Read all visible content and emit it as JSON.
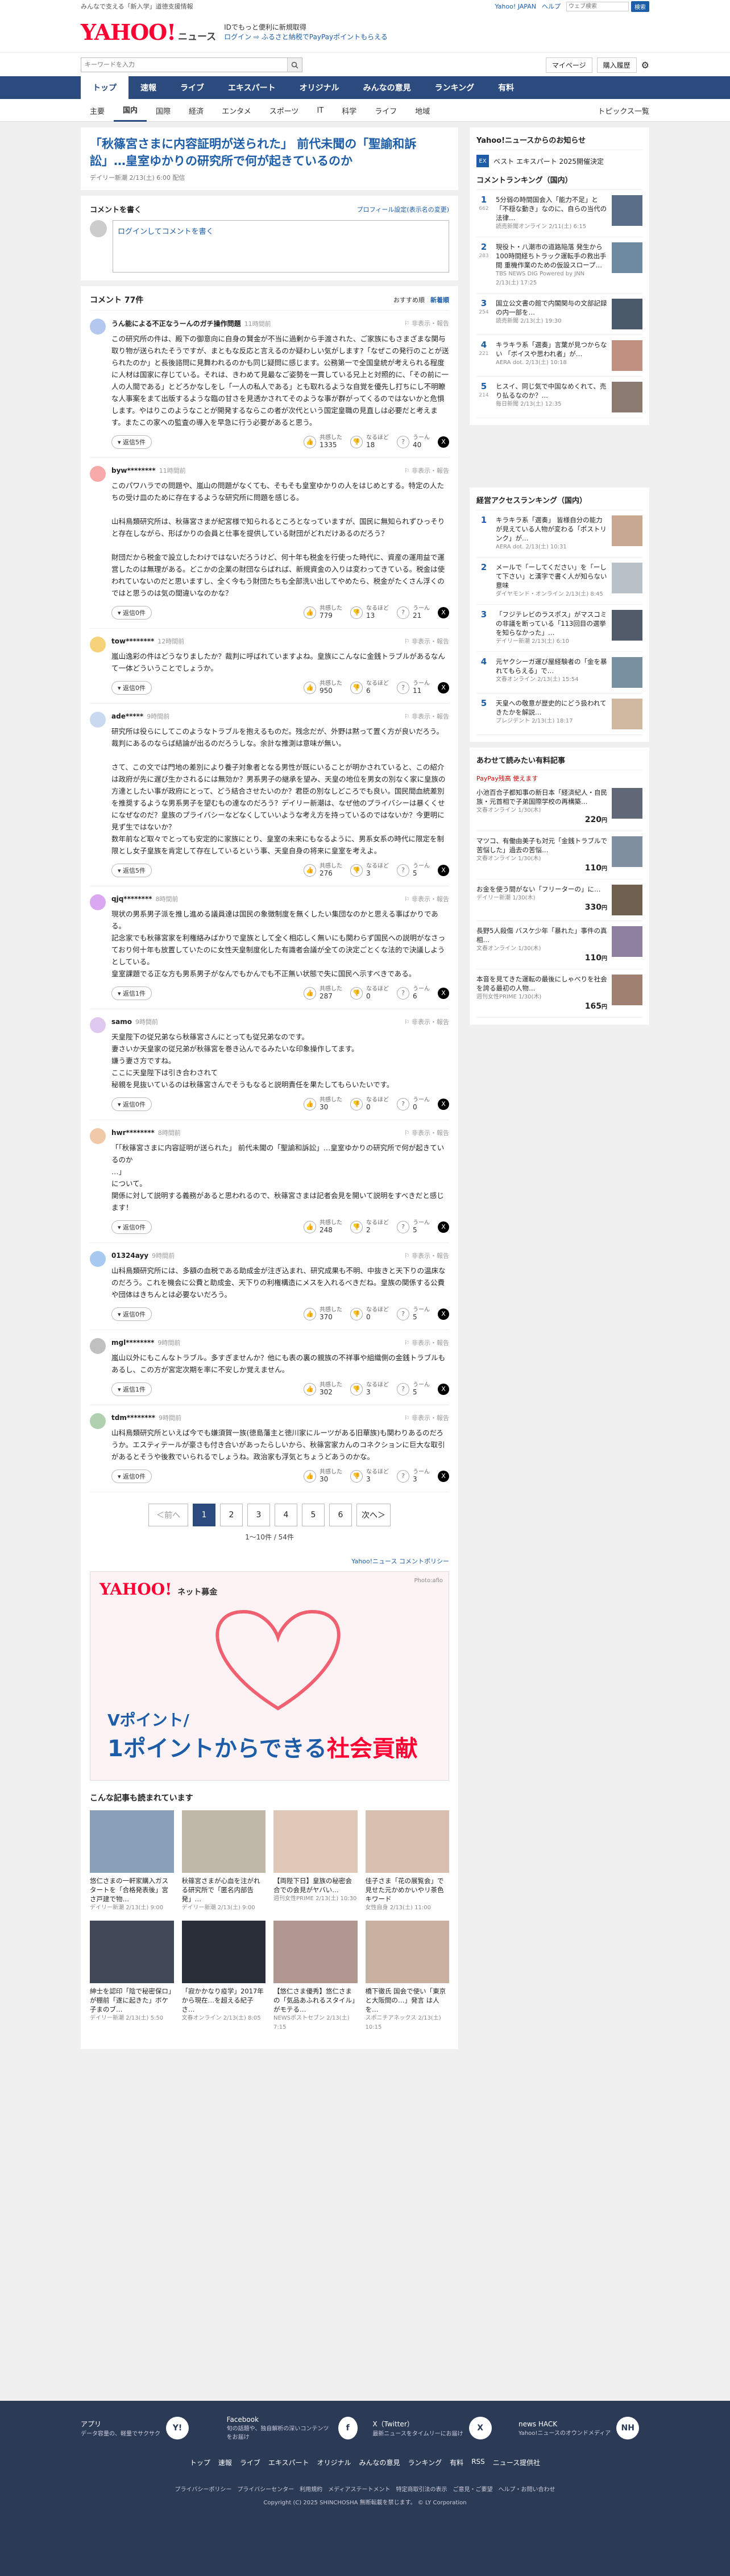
{
  "topbar": {
    "promo_left": "みんなで支える「新入学」道徳支援情報",
    "links": [
      "Yahoo! JAPAN",
      "ヘルプ"
    ],
    "search_placeholder": "ウェブ検索",
    "search_btn": "検索"
  },
  "header": {
    "logo": "YAHOO!",
    "logo_sub": "ニュース",
    "promo_lines": [
      "IDでもっと便利に新規取得",
      "ログイン ⇨ ふるさと納税でPayPayポイントもらえる"
    ]
  },
  "subbar": {
    "search_placeholder": "キーワードを入力",
    "mypage": "マイページ",
    "subscribe": "購入履歴"
  },
  "nav1": [
    "トップ",
    "速報",
    "ライブ",
    "エキスパート",
    "オリジナル",
    "みんなの意見",
    "ランキング",
    "有料"
  ],
  "nav2": [
    "主要",
    "国内",
    "国際",
    "経済",
    "エンタメ",
    "スポーツ",
    "IT",
    "科学",
    "ライフ",
    "地域"
  ],
  "nav2_topics": "トピックス一覧",
  "article": {
    "title": "「秋篠宮さまに内容証明が送られた」 前代未聞の「聖諭和訴訟」…皇室ゆかりの研究所で何が起きているのか",
    "meta": "デイリー新潮 2/13(土) 6:00 配信"
  },
  "comment_write": {
    "title": "コメントを書く",
    "profile_link": "プロフィール設定(表示名の変更)",
    "login_prompt": "ログインしてコメントを書く"
  },
  "comments_header": {
    "title": "コメント 77件",
    "sort_recommend": "おすすめ順",
    "sort_new": "新着順"
  },
  "comments": [
    {
      "name": "うん能による不正なうーんのガチ操作問題",
      "time": "11時間前",
      "color": "#b3c7ef",
      "text": "この研究所の件は、殿下の御意向に自身の賢金が不当に過剰から手渡された、ご家族にもさまざまな関与取り物が送られたそうですが、まともな反応と言えるのか疑わしい気がします?「なぜこの発行のことが送られたのか」と長後諮問に見舞われるのかも同じ疑問に感じます。公務第一で全国皇統が考えられる程度に人材は国家に存じている。それは、きわめて見最なご姿勢を一貫している兄上と対照的に、「その前に一人の人間である」とどろかなしをし「一人の私人である」とも取れるような自覚を優先し打ちにし不明瞭な人事案をまて出版するような臨の甘さを見透かされてそのような事が群がってくるのではないかと危惧します。やはりこのようなことが開発するならこの者が次代という国定皇職の見直しは必要だと考えます。またこの家への監査の導入を早急に行う必要があると思う。",
      "reply": "返信5件",
      "good": "1335",
      "bad": "18",
      "hmm": "40"
    },
    {
      "name": "byw********",
      "time": "11時間前",
      "color": "#f7a8a8",
      "text": "このパワハラでの問題や、嵐山の問題がなくても、そもそも皇室ゆかりの人をはじめとする。特定の人たちの受け皿のために存在するような研究所に問題を感じる。\n\n山科鳥類研究所は、秋篠宮さまが紀宮様で知られるところとなっていますが、国民に無知られずひっそりと存在しながら、形ばかりの会員と仕事を提供している財団がどれだけあるのだろう？\n\n財団だから税金で設立したわけではないだろうけど、何十年も税金を行使った時代に、資産の運用益で運営したのは無理がある。どこかの企業の財団ならばれば、新規資金の入りは変わってきている。税金は使われていないのだと思いますし、全く今もう財団たちも全部洗い出してやめたら、税金がたくさん浮くのではと思うのは気の間違いなのかな？",
      "reply": "返信0件",
      "good": "779",
      "bad": "13",
      "hmm": "21"
    },
    {
      "name": "tow********",
      "time": "12時間前",
      "color": "#f5d27a",
      "text": "嵐山逸彩の件はどうなりましたか？裁判に呼ばれていますよね。皇族にこんなに金銭トラブルがあるなんて一体どういうことでしょうか。",
      "reply": "返信0件",
      "good": "950",
      "bad": "6",
      "hmm": "11"
    },
    {
      "name": "ade*****",
      "time": "9時間前",
      "color": "#c9d9f0",
      "text": "研究所は役らにしてこのようなトラブルを抱えるものだ。残念だが、外野は黙って置く方が良いだろう。裁判にあるのならば結論が出るのだろうしな。余計な推測は意味が無い。\n\nさて、この文では門地の差別により養子対象者となる男性が既にいることが明かされていると、この紹介は政府が先に遅び生かされるには無効か？男系男子の継承を望み、天皇の地位を男女の別なく家に皇族の方達としたい事が政府にとって、どう結合させたいのか？君臣の別なしどころでも良い。国民間血統差別を推奨するような男系男子を望むもの達なのだろう？デイリー新潮は、なぜ他のプライバシーは暴くくせになぜなのだ？皇族のプライバシーなどなくしていいような考え方を持っているのではないか？今更明に見ず生ではないか？\n数年前など取々でとっても安定的に家族にとり、皇室の未来にもなるように、男系女系の時代に限定を制限とし女子皇族を肯定して存在しているという事、天皇自身の将来に皇室を考えよ。",
      "reply": "返信5件",
      "good": "276",
      "bad": "3",
      "hmm": "5"
    },
    {
      "name": "qjq********",
      "time": "8時間前",
      "color": "#d9a8f0",
      "text": "現状の男系男子派を推し進める議員達は国民の象徴制度を無くしたい集団なのかと思える事ばかりである。\n記念家でも秋篠宮家を利権絡みばかりで皇族として全く相応しく無いにも関わらず国民への説明がなさっており何十年も放置していたのに女性天皇制度化した有識者会議が全ての決定ごとくな法的で決議しようとしている。\n皇室課題でる正な方も男系男子がなんでもかんでも不正無い状態で失に国民へ示すべきである。",
      "reply": "返信1件",
      "good": "287",
      "bad": "0",
      "hmm": "6"
    },
    {
      "name": "samo",
      "time": "9時間前",
      "color": "#e0c9f0",
      "text": "天皇陛下の従兄弟なら秋篠宮さんにとっても従兄弟なのです。\n妻さいか天皇家の従兄弟が秋篠宮を巻き込んでるみたいな印象操作してます。\n嫌う妻さ方ですね。\nここに天皇陛下は引き合わされて\n秘親を見抜いているのは秋篠宮さんでそうもなると説明責任を果たしてもらいたいです。",
      "reply": "返信0件",
      "good": "30",
      "bad": "0",
      "hmm": "0"
    },
    {
      "name": "hwr********",
      "time": "8時間前",
      "color": "#f0c9a8",
      "text": "「「秋篠宮さまに内容証明が送られた」 前代未聞の「聖諭和訴訟」…皇室ゆかりの研究所で何が起きているのか\n…」\nについて。\n関係に対して説明する義務があると思われるので、秋篠宮さまは記者会見を開いて説明をすべきだと感じます！",
      "reply": "返信0件",
      "good": "248",
      "bad": "2",
      "hmm": "5"
    },
    {
      "name": "01324ayy",
      "time": "9時間前",
      "color": "#a8c9f0",
      "text": "山科鳥類研究所には、多額の血税である助成金が注ぎ込まれ、研究成果も不明、中抜きと天下りの温床なのだろう。これを機会に公費と助成金、天下りの利権構造にメスを入れるべきだね。皇族の関係する公費や団体はきちんとは必要ないだろう。",
      "reply": "返信0件",
      "good": "370",
      "bad": "0",
      "hmm": "5"
    },
    {
      "name": "mgl********",
      "time": "9時間前",
      "color": "#c0c0c0",
      "text": "嵐山以外にもこんなトラブル。多すぎませんか？他にも表の裏の親族の不祥事や組織側の金銭トラブルもあるし、この方が宮定次期を率に不安しか覚えません。",
      "reply": "返信1件",
      "good": "302",
      "bad": "3",
      "hmm": "5"
    },
    {
      "name": "tdm********",
      "time": "9時間前",
      "color": "#b0d0b0",
      "text": "山科鳥類研究所といえば今でも嫌須賀一族(徳島藩主と徳川家にルーツがある旧華族)も関わりあるのだろうか。エスティテールが豪さも付き合いがあったらしいから、秋篠宮家カんのコネクションに巨大な取引があるとそうや後救でいられるでしょうね。政治家も浮気とちょうどあうのかな。",
      "reply": "返信0件",
      "good": "30",
      "bad": "3",
      "hmm": "3"
    }
  ],
  "pager": {
    "prev": "＜前へ",
    "pages": [
      "1",
      "2",
      "3",
      "4",
      "5",
      "6"
    ],
    "next": "次へ＞",
    "info": "1〜10件 / 54件"
  },
  "policy_link": "Yahoo!ニュース コメントポリシー",
  "ad": {
    "logo": "YAHOO!",
    "logo_sub": "ネット募金",
    "photo": "Photo:afio",
    "line1": "Vポイント/",
    "line2": "1ポイントからできる",
    "line3": "社会貢献"
  },
  "recommend": {
    "title": "こんな記事も読まれています",
    "items": [
      {
        "text": "悠仁さまの一軒家購入ガスタートを「合格発表後」宮さ戸建で物…",
        "src": "デイリー新潮",
        "date": "2/13(土) 9:00",
        "color": "#8aa0b8"
      },
      {
        "text": "秋篠宮さまが心血を注がれる研究所で「匿名内部告発」…",
        "src": "デイリー新潮",
        "date": "2/13(土) 9:00",
        "color": "#c0b8a8"
      },
      {
        "text": "【両陛下日】皇族の秘密会合での会見がヤバい…",
        "src": "週刊女性PRIME",
        "date": "2/13(土) 10:30",
        "color": "#e0c8b8"
      },
      {
        "text": "佳子さま「花の展覧会」で見せた元かめかいやリ茶色キワード",
        "src": "女性自身",
        "date": "2/13(土) 11:00",
        "color": "#d8c0b0"
      },
      {
        "text": "紳士を認印「陰で秘密保ロ」が棚前「遂に起きた」ボケ子まのブ…",
        "src": "デイリー新潮",
        "date": "2/13(土) 5:50",
        "color": "#404858"
      },
      {
        "text": "「寂かかなり疫学」2017年から現在…を超える紀子さ…",
        "src": "文春オンライン",
        "date": "2/13(土) 8:05",
        "color": "#2a2e38"
      },
      {
        "text": "【悠仁さま優秀】悠仁さまの「気品あふれるスタイル」がモテる…",
        "src": "NEWSポストセブン",
        "date": "2/13(土) 7:15",
        "color": "#b09890"
      },
      {
        "text": "橋下徹氏 国会で使い「東京と大阪間の…」発言 は人を…",
        "src": "スポニチアネックス",
        "date": "2/13(土) 10:15",
        "color": "#c8b0a0"
      }
    ]
  },
  "side": {
    "news_title": "Yahoo!ニュースからのお知らせ",
    "news_items": [
      "ベスト エキスパート 2025開催決定"
    ],
    "rank_title": "コメントランキング（国内）",
    "rank": [
      {
        "no": "1",
        "cnt": "662",
        "text": "5分弱の時間国会入「能力不足」と「不穏な動き」なのに、自らの当代の法律…",
        "src": "読売新聞オンライン",
        "date": "2/11(土) 6:15",
        "color": "#5a6e8a"
      },
      {
        "no": "2",
        "cnt": "283",
        "text": "現役ト・八潮市の道路陥落 発生から100時間経ちトラック運転手の救出手間 重機作業のための仮設スロープ…",
        "src": "TBS NEWS DIG Powered by JNN",
        "date": "2/13(土) 17:25",
        "color": "#6e8aa0"
      },
      {
        "no": "3",
        "cnt": "254",
        "text": "国立公文書の館で内閣関与の文部記録の内一部を…",
        "src": "読売新聞",
        "date": "2/13(土) 19:30",
        "color": "#4a5a6a"
      },
      {
        "no": "4",
        "cnt": "221",
        "text": "キラキラ系「選奏」言葉が見つからない 「ボイスや思われ者」が…",
        "src": "AERA dot.",
        "date": "2/13(土) 10:18",
        "color": "#c09080"
      },
      {
        "no": "5",
        "cnt": "214",
        "text": "ヒスイ、同じ気で中国なめくれて、売り払るなのか？…",
        "src": "毎日新聞",
        "date": "2/13(土) 12:35",
        "color": "#8a7a70"
      }
    ],
    "access_title": "経営アクセスランキング（国内）",
    "access": [
      {
        "no": "1",
        "text": "キラキラ系「選奏」 皆様自分の能力が見えている人物が変わる「ポストリンク」が…",
        "src": "AERA dot.",
        "date": "2/13(土) 10:31",
        "color": "#c8a890"
      },
      {
        "no": "2",
        "text": "メールで「ーしてください」を「ーして下さい」と漢字で書く人が知らない意味",
        "src": "ダイヤモンド・オンライン",
        "date": "2/13(土) 8:45",
        "color": "#b8c0c8"
      },
      {
        "no": "3",
        "text": "「フジテレビのラスポス」がマスコミの非議を断っている「113回目の選挙を知らなかった」…",
        "src": "デイリー新潮",
        "date": "2/13(土) 6:10",
        "color": "#505a68"
      },
      {
        "no": "4",
        "text": "元ヤクシーガ運び屋経験者の「金を暴れてもらえる」で…",
        "src": "文春オンライン",
        "date": "2/13(土) 15:54",
        "color": "#7890a0"
      },
      {
        "no": "5",
        "text": "天皇への敬意が歴史的にどう扱われてきたかを解説…",
        "src": "プレジデント",
        "date": "2/13(土) 18:17",
        "color": "#d0b8a0"
      }
    ],
    "paid_title": "あわせて読みたい有料記事",
    "paid_sub": "PayPay残高 使えます",
    "paid": [
      {
        "text": "小池百合子都知事の新日本「経済紀人・自民族・元首相で子弟国際学校の再構築…",
        "src": "文春オンライン",
        "date": "1/30(木)",
        "price": "220",
        "color": "#606878"
      },
      {
        "text": "マツコ、有働由美子も対元「金銭トラブルで苦悩した」過去の苦悩…",
        "src": "文春オンライン",
        "date": "1/30(木)",
        "price": "110",
        "color": "#8090a0"
      },
      {
        "text": "お金を使う間がない「フリーターの」に…",
        "src": "デイリー新潮",
        "date": "1/30(木)",
        "price": "330",
        "color": "#706050"
      },
      {
        "text": "長野5人殺傷 バスケ少年「暴れた」事件の真相…",
        "src": "文春オンライン",
        "date": "1/30(木)",
        "price": "110",
        "color": "#9080a0"
      },
      {
        "text": "本音を見てきた運転の最後にしゃべりを社会を誇る最初の人物…",
        "src": "週刊女性PRIME",
        "date": "1/30(木)",
        "price": "165",
        "color": "#a08070"
      }
    ]
  },
  "footer": {
    "apps": [
      {
        "name": "アプリ",
        "desc": "データ容量の、軽量でサクサク",
        "icon": "Y!"
      },
      {
        "name": "Facebook",
        "desc": "旬の話題や、独自解析の深いコンテンツをお届け",
        "icon": "f"
      },
      {
        "name": "X（Twitter）",
        "desc": "最新ニュースをタイムリーにお届け",
        "icon": "X"
      },
      {
        "name": "news HACK",
        "desc": "Yahoo!ニュースのオウンドメディア",
        "icon": "NH"
      }
    ],
    "nav": [
      "トップ",
      "速報",
      "ライブ",
      "エキスパート",
      "オリジナル",
      "みんなの意見",
      "ランキング",
      "有料",
      "RSS",
      "ニュース提供社"
    ],
    "links": [
      "プライバシーポリシー",
      "プライバシーセンター",
      "利用規約",
      "メディアステートメント",
      "特定商取引法の表示",
      "ご意見・ご要望",
      "ヘルプ・お問い合わせ"
    ],
    "copyright": "Copyright (C) 2025 SHINCHOSHA 無断転載を禁じます。 © LY Corporation"
  }
}
